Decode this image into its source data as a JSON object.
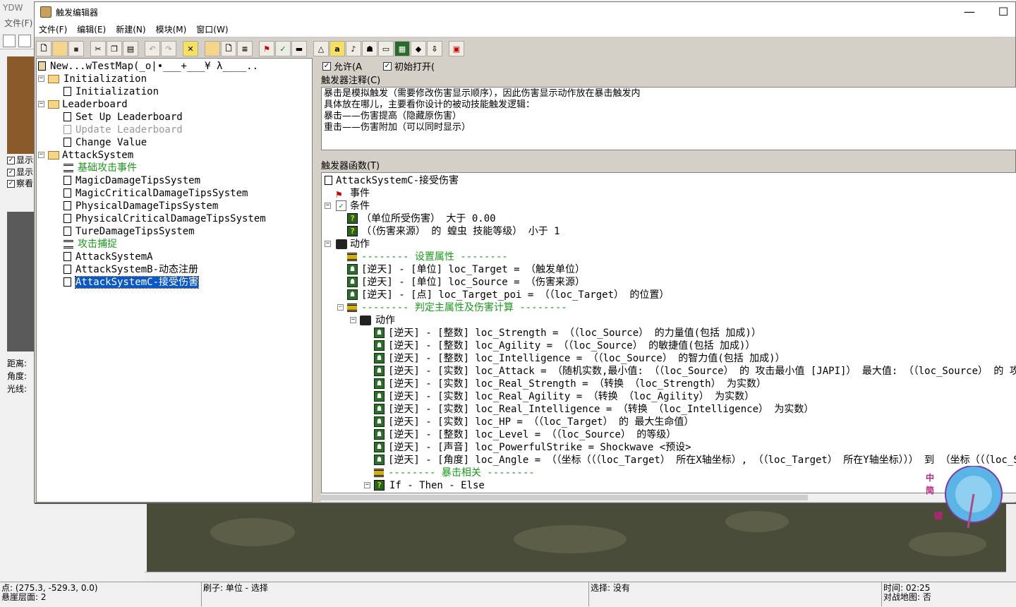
{
  "background_app": {
    "title": "YDW",
    "menu": "文件(F)",
    "checkbox_labels": [
      "显示",
      "显示",
      "察看"
    ],
    "labels": [
      "距离:",
      "角度:",
      "光线:"
    ]
  },
  "window": {
    "title": "触发编辑器",
    "minimize": "—",
    "maximize": "☐"
  },
  "menu": [
    "文件(F)",
    "编辑(E)",
    "新建(N)",
    "模块(M)",
    "窗口(W)"
  ],
  "toolbar_icons": [
    "new-icon",
    "open-icon",
    "save-icon",
    "cut-icon",
    "copy-icon",
    "paste-icon",
    "undo-icon",
    "redo-icon",
    "delete-icon",
    "new-category-icon",
    "new-trigger-icon",
    "new-comment-icon",
    "new-event-icon",
    "new-condition-icon",
    "new-action-icon",
    "terrain-icon",
    "text-icon",
    "sound-icon",
    "unit-icon",
    "object-editor-icon",
    "camera-icon",
    "ai-icon",
    "import-icon",
    "test-map-icon"
  ],
  "tree": {
    "map": "New...wTestMap(_o|•___+___¥ λ____..",
    "items": [
      "Initialization",
      "Initialization",
      "Leaderboard",
      "Set Up Leaderboard",
      "Update Leaderboard",
      "Change Value",
      "AttackSystem",
      "基础攻击事件",
      "MagicDamageTipsSystem",
      "MagicCriticalDamageTipsSystem",
      "PhysicalDamageTipsSystem",
      "PhysicalCriticalDamageTipsSystem",
      "TureDamageTipsSystem",
      "攻击捕捉",
      "AttackSystemA",
      "AttackSystemB-动态注册",
      "AttackSystemC-接受伤害"
    ]
  },
  "enabled_label": "允许(A",
  "initially_on_label": "初始打开(",
  "comment_label": "触发器注释(C)",
  "comment_text": "暴击是模拟触发（需要修改伤害显示顺序），因此伤害显示动作放在暴击触发内\n具体放在哪儿，主要看你设计的被动技能触发逻辑：\n暴击——伤害提高（隐藏原伤害）\n重击——伤害附加（可以同时显示）",
  "func_label": "触发器函数(T)",
  "func": {
    "root": "AttackSystemC-接受伤害",
    "events": "事件",
    "conditions": "条件",
    "cond1": "（单位所受伤害） 大于 0.00",
    "cond2": "（（伤害来源） 的 蝗虫 技能等级） 小于 1",
    "actions": "动作",
    "lines": [
      "-------- 设置属性 --------",
      "[逆天] - [单位] loc_Target = （触发单位）",
      "[逆天] - [单位] loc_Source = （伤害来源）",
      "[逆天] - [点] loc_Target_poi = （（loc_Target） 的位置）",
      "-------- 判定主属性及伤害计算 --------",
      "动作",
      "[逆天] - [整数] loc_Strength = （（loc_Source） 的力量值(包括 加成)）",
      "[逆天] - [整数] loc_Agility = （（loc_Source） 的敏捷值(包括 加成)）",
      "[逆天] - [整数] loc_Intelligence = （（loc_Source） 的智力值(包括 加成)）",
      "[逆天] - [实数] loc_Attack = （随机实数,最小值: （（loc_Source） 的 攻击最小值 [JAPI]） 最大值: （（loc_Source） 的 攻击",
      "[逆天] - [实数] loc_Real_Strength = （转换 （loc_Strength） 为实数）",
      "[逆天] - [实数] loc_Real_Agility = （转换 （loc_Agility） 为实数）",
      "[逆天] - [实数] loc_Real_Intelligence = （转换 （loc_Intelligence） 为实数）",
      "[逆天] - [实数] loc_HP = （（loc_Target） 的 最大生命值）",
      "[逆天] - [整数] loc_Level = （（loc_Source） 的等级）",
      "[逆天] - [声音] loc_PowerfulStrike = Shockwave <预设>",
      "[逆天] - [角度] loc_Angle = （（坐标（（（loc_Target） 所在X轴坐标）, （（loc_Target） 所在Y轴坐标））） 到 （坐标（（（loc_Sour",
      "-------- 暴击相关 --------",
      "If - Then - Else"
    ]
  },
  "status": {
    "point": "点: (275.3, -529.3, 0.0)",
    "layer": "悬崖层面: 2",
    "brush": "刷子: 单位 - 选择",
    "selection": "选择: 没有",
    "time": "时间: 02:25",
    "melee": "对战地图: 否"
  },
  "ime": {
    "line1": "中",
    "line2": "简",
    "line3": "键"
  }
}
